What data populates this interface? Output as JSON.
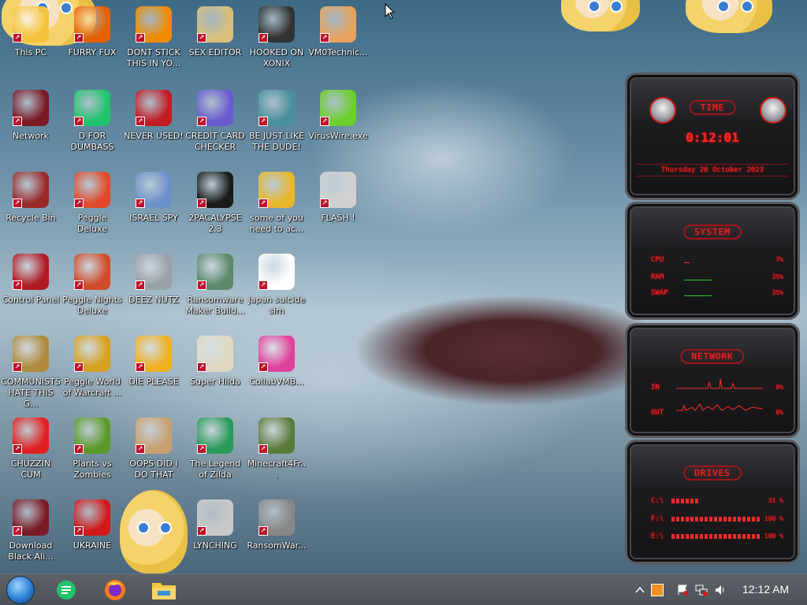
{
  "desktop": {
    "icons": [
      {
        "label": "This PC",
        "icon": "this-pc-icon",
        "color": "#f4c33a"
      },
      {
        "label": "FURRY FUX",
        "icon": "firefox-icon",
        "color": "#e66000"
      },
      {
        "label": "DONT STICK THIS IN YO...",
        "icon": "vlc-icon",
        "color": "#f08a00"
      },
      {
        "label": "SEX EDITOR",
        "icon": "hex-editor-icon",
        "color": "#d9c07a"
      },
      {
        "label": "HOOKED ON XONIX",
        "icon": "xonix-icon",
        "color": "#333333"
      },
      {
        "label": "VM0Technic...",
        "icon": "doctor-icon",
        "color": "#e7a35d"
      },
      {
        "label": "Network",
        "icon": "network-icon",
        "color": "#7a1a24"
      },
      {
        "label": "D FOR DUMBASS",
        "icon": "docs-icon",
        "color": "#21c46b"
      },
      {
        "label": "NEVER USED!",
        "icon": "devcpp-icon",
        "color": "#c21c24"
      },
      {
        "label": "CREDIT CARD CHECKER",
        "icon": "credit-card-icon",
        "color": "#6a5ad0"
      },
      {
        "label": "BE JUST LIKE THE DUDE!",
        "icon": "dude-icon",
        "color": "#4a8f9c"
      },
      {
        "label": "VirusWire.exe",
        "icon": "lime-icon",
        "color": "#6ccf2c"
      },
      {
        "label": "Recycle Bin",
        "icon": "recycle-bin-icon",
        "color": "#9a2a2a"
      },
      {
        "label": "Peggle Deluxe",
        "icon": "peggle-icon",
        "color": "#e04a2a"
      },
      {
        "label": "ISRAEL SPY",
        "icon": "spy-icon",
        "color": "#6b8fc9"
      },
      {
        "label": "2PACALYPSE 2.3",
        "icon": "terminal-icon",
        "color": "#1a1a1a"
      },
      {
        "label": "some of you need to ac...",
        "icon": "scooby-icon",
        "color": "#e8b82a"
      },
      {
        "label": "FLASH !",
        "icon": "flash-icon",
        "color": "#d0d0d0"
      },
      {
        "label": "Control Panel",
        "icon": "control-panel-icon",
        "color": "#b01a22"
      },
      {
        "label": "Peggle Nights Deluxe",
        "icon": "peggle-nights-icon",
        "color": "#d14a2a"
      },
      {
        "label": "DEEZ NUTZ",
        "icon": "windows-stack-icon",
        "color": "#9aa0a8"
      },
      {
        "label": "Ransomware Maker Build...",
        "icon": "ransomware-builder-icon",
        "color": "#5a8a6a"
      },
      {
        "label": "japan suicide sim",
        "icon": "japan-sim-icon",
        "color": "#ffffff"
      },
      {
        "label": "COMMUNISTS HATE THIS G...",
        "icon": "money-bag-icon",
        "color": "#b08a3a"
      },
      {
        "label": "Peggle World of Warcraft ...",
        "icon": "peggle-wow-icon",
        "color": "#d8a020"
      },
      {
        "label": "DIE PLEASE",
        "icon": "de-icon",
        "color": "#f0b020"
      },
      {
        "label": "Super Hilda",
        "icon": "pixel-hilda-icon",
        "color": "#e0d8c0"
      },
      {
        "label": "CollabVMB...",
        "icon": "collabvm-icon",
        "color": "#e0409a"
      },
      {
        "label": "CHUZZIN CUM",
        "icon": "chuzzle-icon",
        "color": "#e02020"
      },
      {
        "label": "Plants vs Zombies",
        "icon": "plants-vs-zombies-icon",
        "color": "#5a9a2a"
      },
      {
        "label": "OOPS DID I DO THAT",
        "icon": "portrait-icon",
        "color": "#c8a070"
      },
      {
        "label": "The Legend of Zilda",
        "icon": "zelda-icon",
        "color": "#2a9a5a"
      },
      {
        "label": "Minecraft4Fr...",
        "icon": "minecraft-icon",
        "color": "#5a7a3a"
      },
      {
        "label": "Download Black Ali...",
        "icon": "alien-download-icon",
        "color": "#7a1a24"
      },
      {
        "label": "UKRAINE",
        "icon": "radiation-icon",
        "color": "#d01a1a"
      },
      {
        "label": "LYNCHING",
        "icon": "noose-icon",
        "color": "#c8c8c8"
      },
      {
        "label": "RansomWar...",
        "icon": "skull-icon",
        "color": "#888888"
      }
    ]
  },
  "gadgets": {
    "time": {
      "title": "TIME",
      "clock": "0:12:01",
      "date": "Thursday 26 October 2023"
    },
    "system": {
      "title": "SYSTEM",
      "rows": [
        {
          "label": "CPU",
          "value": "7%",
          "fraction": 0.07
        },
        {
          "label": "RAM",
          "value": "35%",
          "fraction": 0.35
        },
        {
          "label": "SWAP",
          "value": "35%",
          "fraction": 0.35
        }
      ]
    },
    "network": {
      "title": "NETWORK",
      "rows": [
        {
          "label": "IN",
          "value": "0%"
        },
        {
          "label": "OUT",
          "value": "0%"
        }
      ]
    },
    "drives": {
      "title": "DRIVES",
      "rows": [
        {
          "label": "C:\\",
          "value": "31 %",
          "fraction": 0.31
        },
        {
          "label": "F:\\",
          "value": "100 %",
          "fraction": 1.0
        },
        {
          "label": "E:\\",
          "value": "100 %",
          "fraction": 1.0
        }
      ]
    }
  },
  "taskbar": {
    "start_icon": "start-orb-icon",
    "pinned": [
      "docs-app-icon",
      "firefox-icon",
      "file-explorer-icon"
    ],
    "tray": [
      "chevron-up-icon",
      "security-icon",
      "flag-icon",
      "network-icon",
      "volume-icon"
    ],
    "clock": "12:12 AM"
  },
  "colors": {
    "accent_red": "#ff2a2a",
    "taskbar": "#555b61"
  }
}
